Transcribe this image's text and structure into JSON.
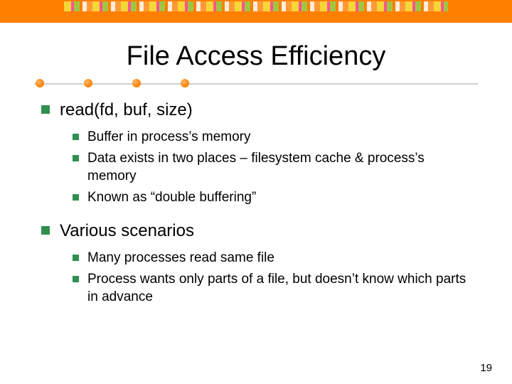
{
  "title": "File Access Efficiency",
  "bullets": [
    {
      "text": "read(fd, buf, size)",
      "children": [
        "Buffer in process’s memory",
        "Data exists in two places – filesystem cache & process’s memory",
        "Known as “double buffering”"
      ]
    },
    {
      "text": "Various scenarios",
      "children": [
        "Many processes read same file",
        "Process wants only parts of a file, but doesn’t know which parts in advance"
      ]
    }
  ],
  "page_number": "19"
}
